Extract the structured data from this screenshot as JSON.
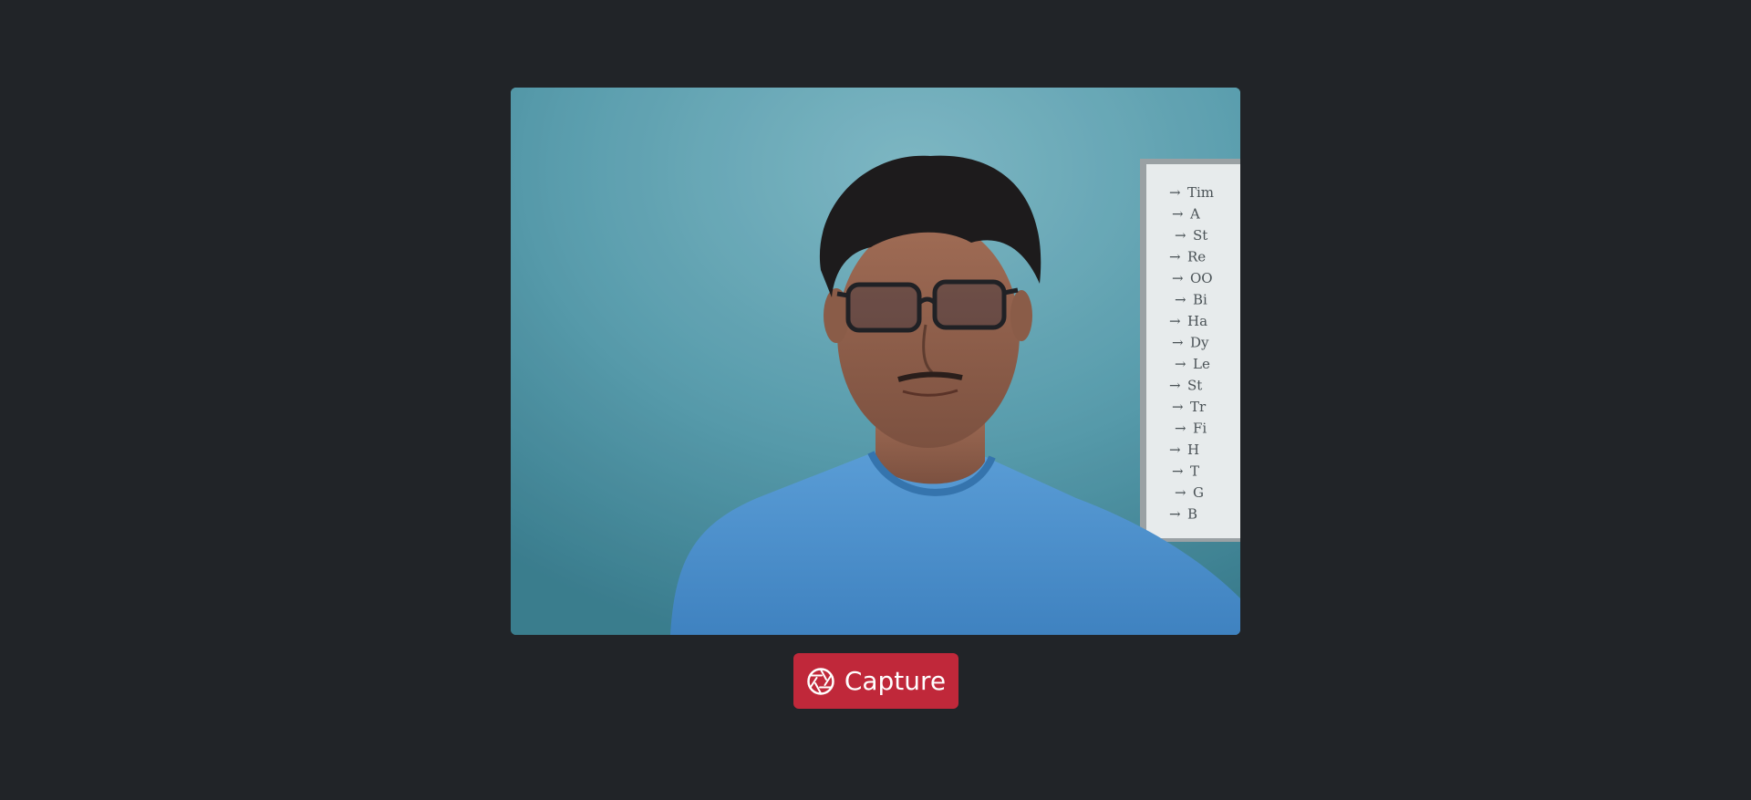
{
  "page": {
    "background_color": "#212428"
  },
  "webcam": {
    "icon": "webcam-feed",
    "whiteboard_lines": [
      "Tim",
      "A",
      "St",
      "Re",
      "OO",
      "Bi",
      "Ha",
      "Dy",
      "Le",
      "St",
      "Tr",
      "Fi",
      "H",
      "T",
      "G",
      "B"
    ]
  },
  "capture_button": {
    "label": "Capture",
    "icon": "camera-aperture-icon",
    "color": "#c0283a"
  }
}
